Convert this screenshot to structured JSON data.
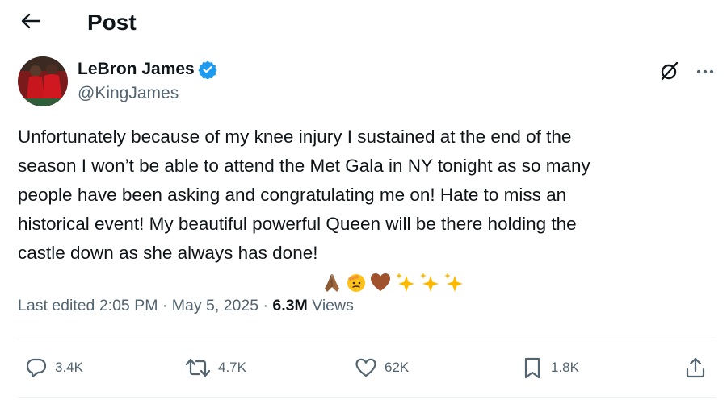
{
  "header": {
    "title": "Post",
    "back_icon": "arrow-left-icon"
  },
  "author": {
    "name": "LeBron James",
    "handle": "@KingJames",
    "verified": true,
    "verified_color": "#1d9bf0"
  },
  "toolbar": {
    "grok_icon": "grok-icon",
    "more_icon": "more-icon"
  },
  "post": {
    "text": "Unfortunately because of my knee injury I sustained at the end of the\nseason I won’t be able to attend the Met Gala in NY tonight as so many\npeople have been asking and congratulating me on! Hate to miss an\nhistorical event! My beautiful powerful Queen will be there holding the\ncastle down as she always has done!",
    "emojis": [
      "folded-hands-emoji",
      "saluting-face-emoji",
      "brown-heart-emoji",
      "sparkles-emoji",
      "sparkles-emoji",
      "sparkles-emoji"
    ]
  },
  "meta": {
    "edited": "Last edited 2:05 PM · May 5, 2025 · ",
    "views_count": "6.3M",
    "views_label": " Views"
  },
  "actions": {
    "replies": "3.4K",
    "reposts": "4.7K",
    "likes": "62K",
    "bookmarks": "1.8K"
  },
  "colors": {
    "text": "#0f1419",
    "secondary": "#536471",
    "divider": "#eff3f4",
    "verified": "#1d9bf0"
  }
}
